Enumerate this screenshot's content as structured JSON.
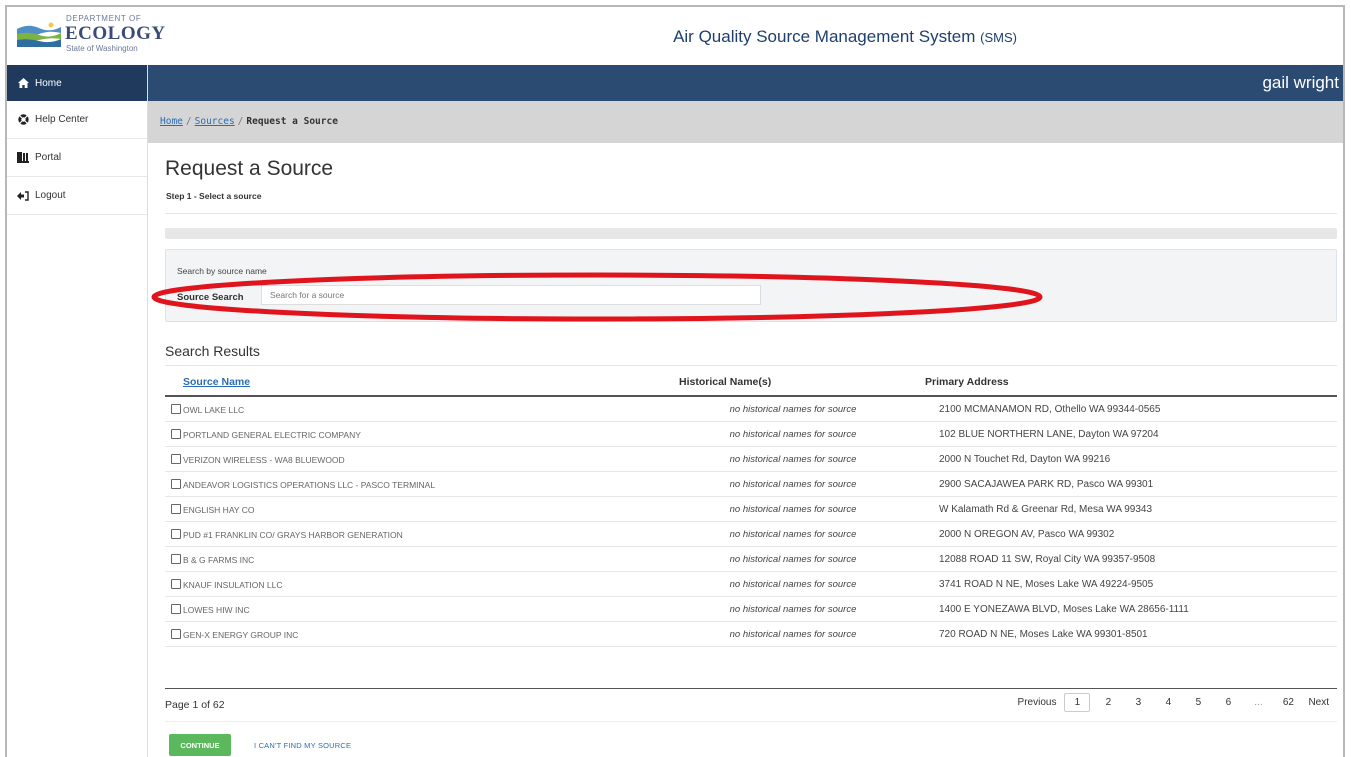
{
  "header": {
    "logo_dept": "DEPARTMENT OF",
    "logo_name": "ECOLOGY",
    "logo_state": "State of Washington",
    "app_title": "Air Quality Source Management System",
    "app_abbr": "(SMS)",
    "user_name": "gail wright"
  },
  "sidebar": {
    "items": [
      {
        "label": "Home",
        "icon": "home-icon"
      },
      {
        "label": "Help Center",
        "icon": "help-icon"
      },
      {
        "label": "Portal",
        "icon": "portal-icon"
      },
      {
        "label": "Logout",
        "icon": "logout-icon"
      }
    ]
  },
  "breadcrumb": {
    "home": "Home",
    "sources": "Sources",
    "current": "Request a Source",
    "separator": "/"
  },
  "page": {
    "title": "Request a Source",
    "step": "Step 1 - Select a source"
  },
  "search": {
    "hint": "Search by source name",
    "label": "Source Search",
    "placeholder": "Search for a source",
    "value": ""
  },
  "results": {
    "title": "Search Results",
    "columns": [
      "Source Name",
      "Historical Name(s)",
      "Primary Address"
    ],
    "rows": [
      {
        "name": "OWL LAKE LLC",
        "historical": "no historical names for source",
        "address": "2100 MCMANAMON RD, Othello WA 99344-0565"
      },
      {
        "name": "PORTLAND GENERAL ELECTRIC COMPANY",
        "historical": "no historical names for source",
        "address": "102 BLUE NORTHERN LANE, Dayton WA 97204"
      },
      {
        "name": "VERIZON WIRELESS - WA8 BLUEWOOD",
        "historical": "no historical names for source",
        "address": "2000 N Touchet Rd, Dayton WA 99216"
      },
      {
        "name": "ANDEAVOR LOGISTICS OPERATIONS LLC - PASCO TERMINAL",
        "historical": "no historical names for source",
        "address": "2900 SACAJAWEA PARK RD, Pasco WA 99301"
      },
      {
        "name": "ENGLISH HAY CO",
        "historical": "no historical names for source",
        "address": "W Kalamath Rd & Greenar Rd, Mesa WA 99343"
      },
      {
        "name": "PUD #1 FRANKLIN CO/ GRAYS HARBOR GENERATION",
        "historical": "no historical names for source",
        "address": "2000 N OREGON AV, Pasco WA 99302"
      },
      {
        "name": "B & G FARMS INC",
        "historical": "no historical names for source",
        "address": "12088 ROAD 11 SW, Royal City WA 99357-9508"
      },
      {
        "name": "KNAUF INSULATION LLC",
        "historical": "no historical names for source",
        "address": "3741 ROAD N NE, Moses Lake WA 49224-9505"
      },
      {
        "name": "LOWES HIW INC",
        "historical": "no historical names for source",
        "address": "1400 E YONEZAWA BLVD, Moses Lake WA 28656-1111"
      },
      {
        "name": "GEN-X ENERGY GROUP INC",
        "historical": "no historical names for source",
        "address": "720 ROAD N NE, Moses Lake WA 99301-8501"
      }
    ]
  },
  "pager": {
    "info": "Page 1 of 62",
    "previous": "Previous",
    "pages": [
      "1",
      "2",
      "3",
      "4",
      "5",
      "6"
    ],
    "ellipsis": "...",
    "last": "62",
    "next": "Next",
    "current": "1"
  },
  "actions": {
    "continue": "CONTINUE",
    "cant_find": "I CAN'T FIND MY SOURCE"
  },
  "colors": {
    "navbar": "#2b4b73",
    "sidebar_active": "#1f3a5c",
    "link": "#2d6db5",
    "continue_button": "#5cb85c",
    "annotation_ellipse": "#e0141c"
  }
}
